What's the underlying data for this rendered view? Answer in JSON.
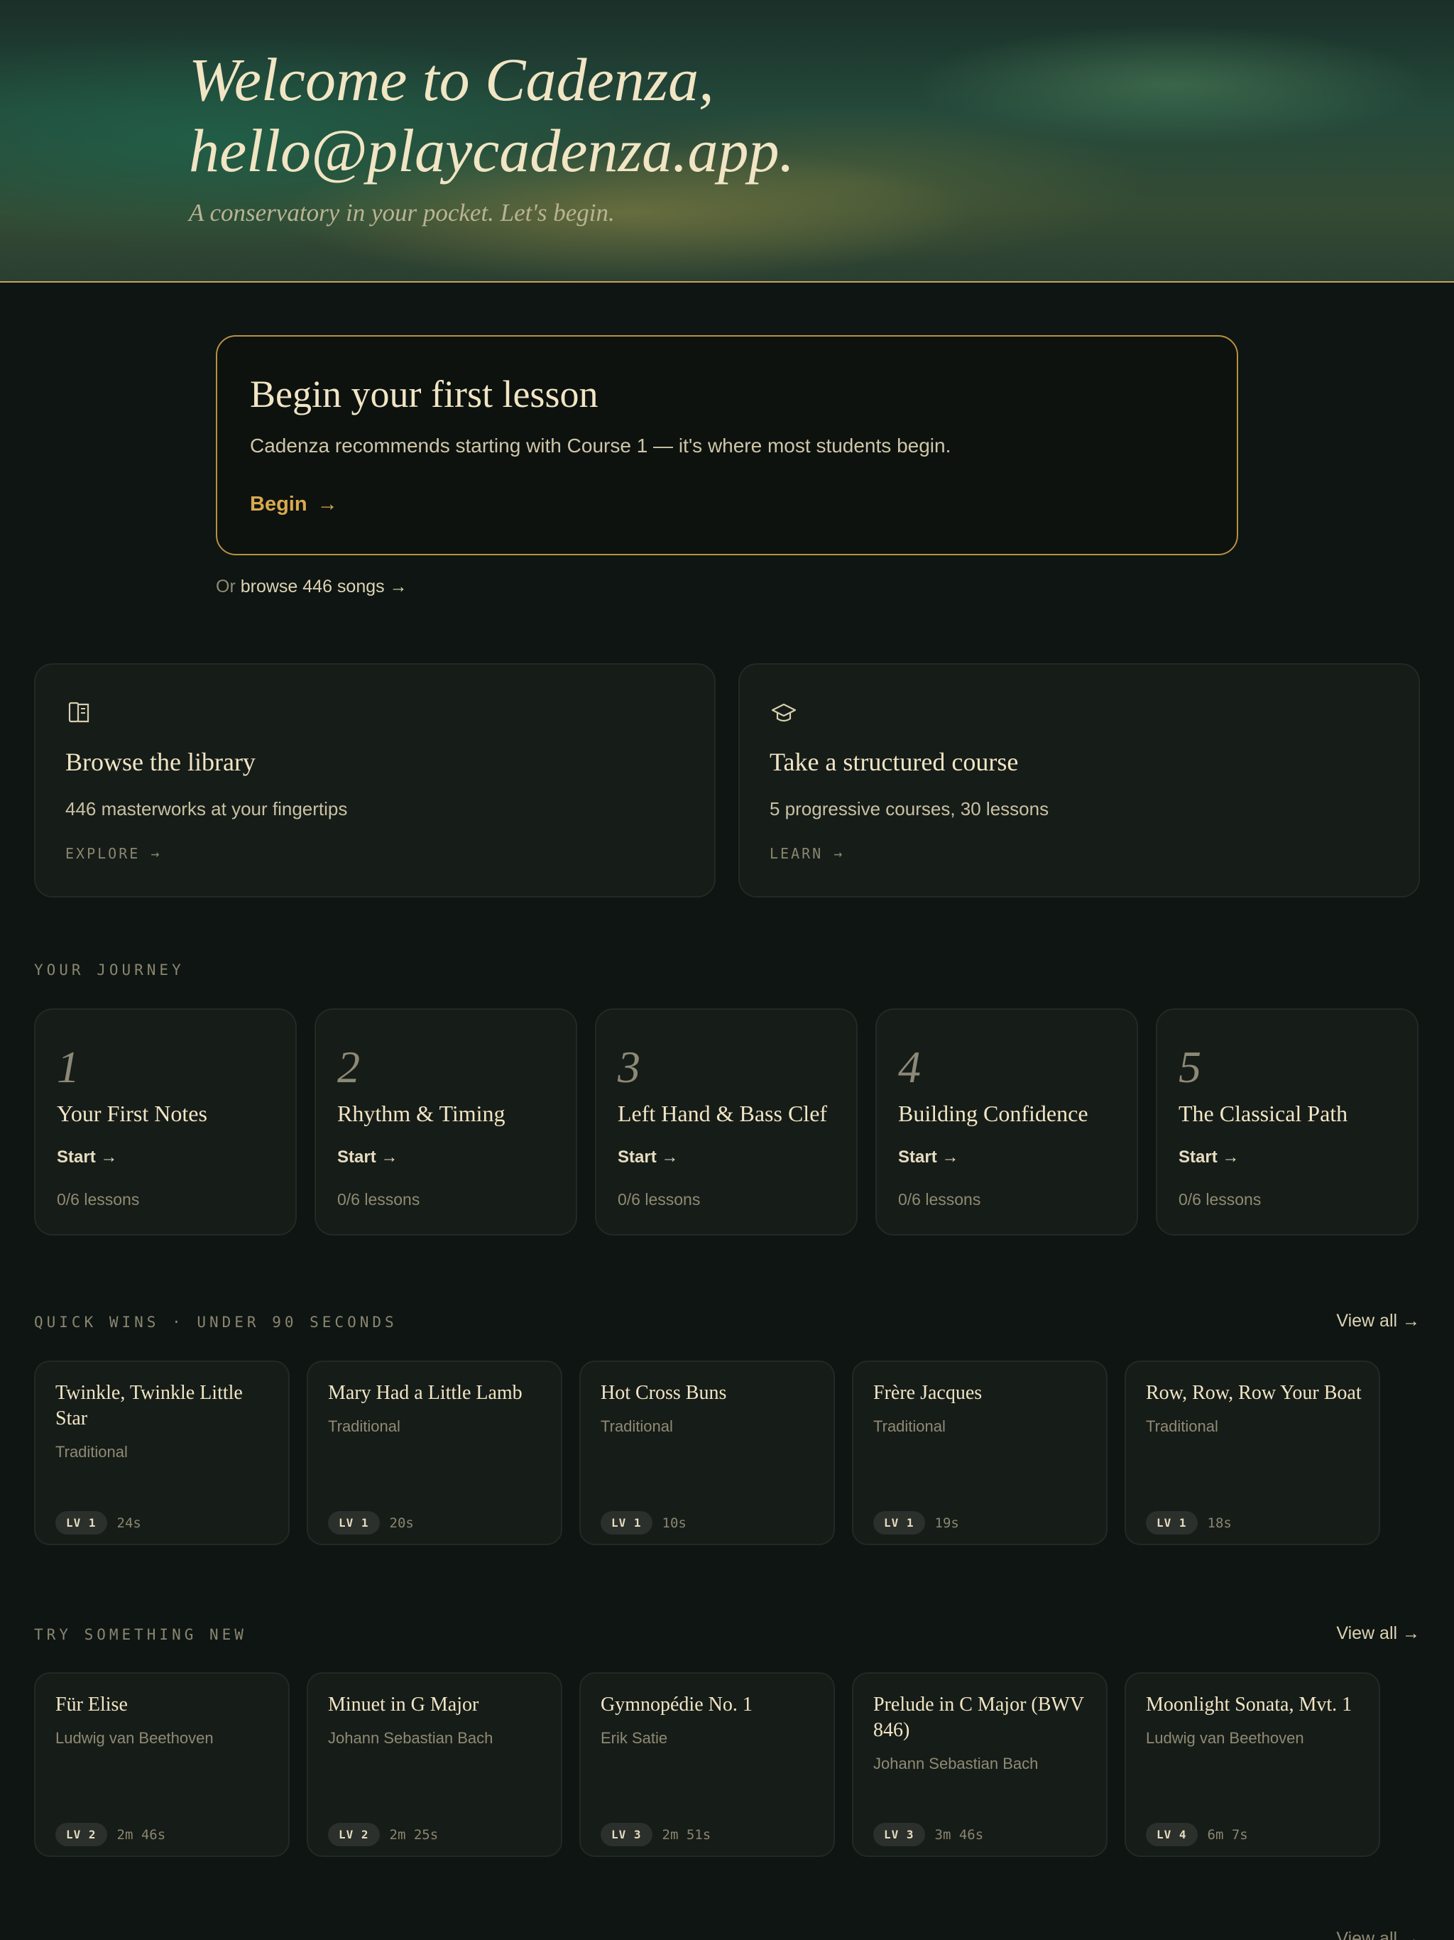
{
  "hero": {
    "title_line1": "Welcome to Cadenza,",
    "title_line2": "hello@playcadenza.app.",
    "subtitle": "A conservatory in your pocket. Let's begin."
  },
  "begin": {
    "title": "Begin your first lesson",
    "description": "Cadenza recommends starting with Course 1 — it's where most students begin.",
    "button_label": "Begin",
    "button_arrow": "→",
    "browse_prefix": "Or",
    "browse_link": "browse 446 songs →"
  },
  "features": [
    {
      "icon": "book-icon",
      "title": "Browse the library",
      "description": "446 masterworks at your fingertips",
      "link": "EXPLORE →"
    },
    {
      "icon": "graduation-cap-icon",
      "title": "Take a structured course",
      "description": "5 progressive courses, 30 lessons",
      "link": "LEARN →"
    }
  ],
  "journey": {
    "label": "YOUR JOURNEY",
    "courses": [
      {
        "number": "1",
        "title": "Your First Notes",
        "action": "Start →",
        "progress": "0/6 lessons"
      },
      {
        "number": "2",
        "title": "Rhythm & Timing",
        "action": "Start →",
        "progress": "0/6 lessons"
      },
      {
        "number": "3",
        "title": "Left Hand & Bass Clef",
        "action": "Start →",
        "progress": "0/6 lessons"
      },
      {
        "number": "4",
        "title": "Building Confidence",
        "action": "Start →",
        "progress": "0/6 lessons"
      },
      {
        "number": "5",
        "title": "The Classical Path",
        "action": "Start →",
        "progress": "0/6 lessons"
      }
    ]
  },
  "quick_wins": {
    "label": "QUICK WINS · UNDER 90 SECONDS",
    "view_all": "View all →",
    "songs": [
      {
        "title": "Twinkle, Twinkle Little Star",
        "composer": "Traditional",
        "level": "LV 1",
        "duration": "24s"
      },
      {
        "title": "Mary Had a Little Lamb",
        "composer": "Traditional",
        "level": "LV 1",
        "duration": "20s"
      },
      {
        "title": "Hot Cross Buns",
        "composer": "Traditional",
        "level": "LV 1",
        "duration": "10s"
      },
      {
        "title": "Frère Jacques",
        "composer": "Traditional",
        "level": "LV 1",
        "duration": "19s"
      },
      {
        "title": "Row, Row, Row Your Boat",
        "composer": "Traditional",
        "level": "LV 1",
        "duration": "18s"
      }
    ]
  },
  "try_new": {
    "label": "TRY SOMETHING NEW",
    "view_all": "View all →",
    "songs": [
      {
        "title": "Für Elise",
        "composer": "Ludwig van Beethoven",
        "level": "LV 2",
        "duration": "2m 46s"
      },
      {
        "title": "Minuet in G Major",
        "composer": "Johann Sebastian Bach",
        "level": "LV 2",
        "duration": "2m 25s"
      },
      {
        "title": "Gymnopédie No. 1",
        "composer": "Erik Satie",
        "level": "LV 3",
        "duration": "2m 51s"
      },
      {
        "title": "Prelude in C Major (BWV 846)",
        "composer": "Johann Sebastian Bach",
        "level": "LV 3",
        "duration": "3m 46s"
      },
      {
        "title": "Moonlight Sonata, Mvt. 1",
        "composer": "Ludwig van Beethoven",
        "level": "LV 4",
        "duration": "6m 7s"
      }
    ]
  },
  "footer_peek": "View all →"
}
